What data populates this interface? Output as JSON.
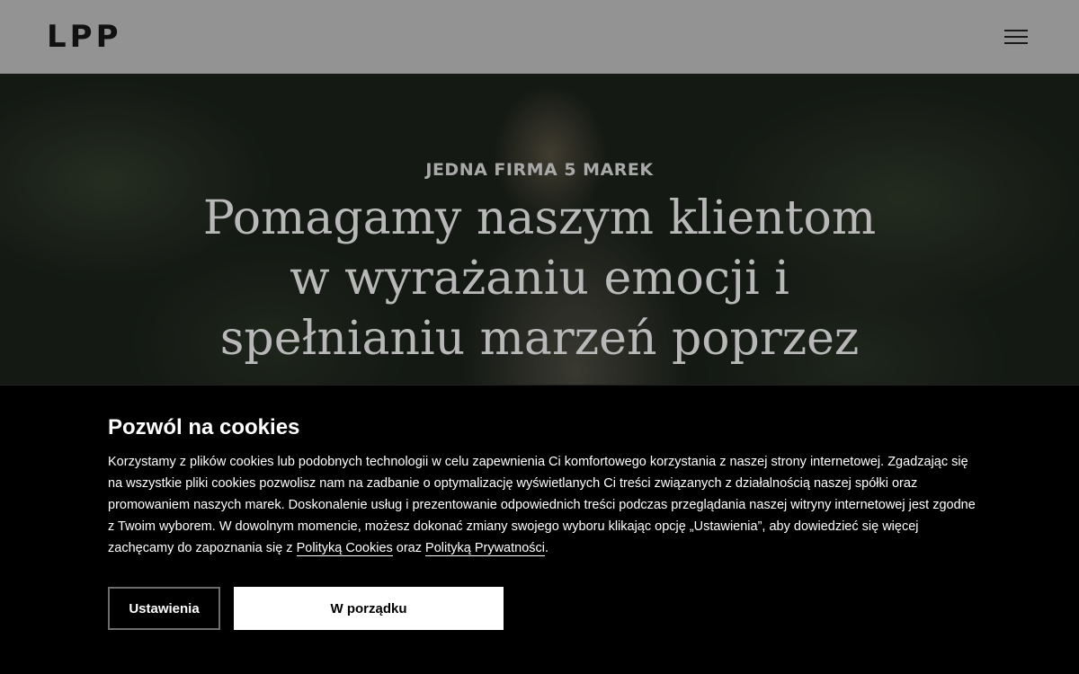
{
  "header": {
    "logo": "LPP",
    "menu_icon": "hamburger-menu-icon"
  },
  "hero": {
    "eyebrow": "JEDNA FIRMA 5 MAREK",
    "title_lines": [
      "Pomagamy naszym klientom",
      "w wyrażaniu emocji i",
      "spełnianiu marzeń poprzez"
    ]
  },
  "cookie_banner": {
    "title": "Pozwól na cookies",
    "text_before": "Korzystamy z plików cookies lub podobnych technologii w celu zapewnienia Ci komfortowego korzystania z naszej strony internetowej. Zgadzając się na wszystkie pliki cookies pozwolisz nam na zadbanie o optymalizację wyświetlanych Ci treści związanych z działalnością naszej spółki oraz promowaniem naszych marek. Doskonalenie usług i prezentowanie odpowiednich treści podczas przeglądania naszej witryny internetowej jest zgodne z Twoim wyborem. W dowolnym momencie, możesz dokonać zmiany swojego wyboru klikając opcję „Ustawienia”, aby dowiedzieć się więcej zachęcamy do zapoznania się z ",
    "link_cookies": "Polityką Cookies",
    "text_middle": " oraz ",
    "link_privacy": "Polityką Prywatności",
    "text_after": ".",
    "settings_button": "Ustawienia",
    "accept_button": "W porządku"
  }
}
